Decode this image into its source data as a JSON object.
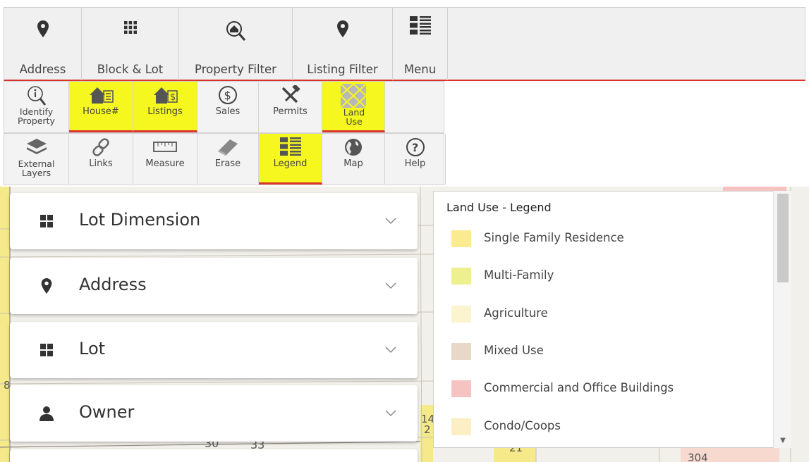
{
  "toolbar": {
    "items": [
      {
        "label": "Address",
        "icon": "map-marker-icon"
      },
      {
        "label": "Block & Lot",
        "icon": "grid-icon"
      },
      {
        "label": "Property Filter",
        "icon": "home-search-icon"
      },
      {
        "label": "Listing Filter",
        "icon": "map-marker-icon"
      },
      {
        "label": "Menu",
        "icon": "list-menu-icon"
      }
    ]
  },
  "tools_row2": {
    "items": [
      {
        "label": "Identify Property",
        "icon": "info-magnifier-icon",
        "active": false
      },
      {
        "label": "House#",
        "icon": "house-number-icon",
        "active": true
      },
      {
        "label": "Listings",
        "icon": "house-dollar-icon",
        "active": true
      },
      {
        "label": "Sales",
        "icon": "dollar-circle-icon",
        "active": false
      },
      {
        "label": "Permits",
        "icon": "tools-icon",
        "active": false
      },
      {
        "label": "Land Use",
        "icon": "land-use-icon",
        "active": true
      }
    ]
  },
  "tools_row3": {
    "items": [
      {
        "label": "External Layers",
        "icon": "layers-icon",
        "active": false
      },
      {
        "label": "Links",
        "icon": "link-icon",
        "active": false
      },
      {
        "label": "Measure",
        "icon": "ruler-icon",
        "active": false
      },
      {
        "label": "Erase",
        "icon": "eraser-icon",
        "active": false
      },
      {
        "label": "Legend",
        "icon": "legend-icon",
        "active": true
      },
      {
        "label": "Map",
        "icon": "globe-icon",
        "active": false
      },
      {
        "label": "Help",
        "icon": "question-circle-icon",
        "active": false
      }
    ]
  },
  "search_panels": [
    {
      "label": "Lot Dimension",
      "icon": "grid-icon"
    },
    {
      "label": "Address",
      "icon": "map-marker-icon"
    },
    {
      "label": "Lot",
      "icon": "grid-icon"
    },
    {
      "label": "Owner",
      "icon": "user-icon"
    }
  ],
  "legend": {
    "title": "Land Use - Legend",
    "items": [
      {
        "label": "Single Family Residence",
        "color": "#fbeb8f"
      },
      {
        "label": "Multi-Family",
        "color": "#eef08d"
      },
      {
        "label": "Agriculture",
        "color": "#fcf4cf"
      },
      {
        "label": "Mixed Use",
        "color": "#e8d8c8"
      },
      {
        "label": "Commercial and Office Buildings",
        "color": "#f6c3c3"
      },
      {
        "label": "Condo/Coops",
        "color": "#fbefc3"
      }
    ]
  },
  "colors": {
    "active_tool": "#f6f71f",
    "active_underline": "#d9332b"
  },
  "map_labels": {
    "lot_a": "30",
    "lot_b": "33",
    "lot_c": "14",
    "lot_d": "2",
    "lot_e": "21",
    "lot_f": "8",
    "lot_g": "304"
  }
}
